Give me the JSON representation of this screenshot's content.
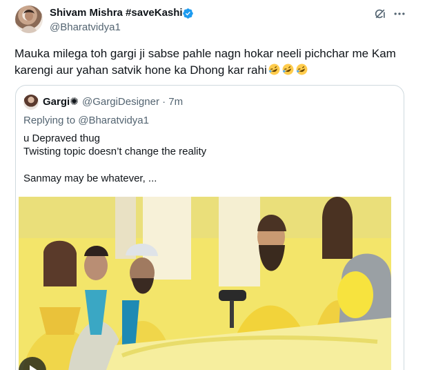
{
  "tweet": {
    "author_name": "Shivam Mishra #saveKashi",
    "author_handle": "@Bharatvidya1",
    "text": "Mauka milega toh gargi ji sabse pahle nagn hokar neeli pichchar me Kam karengi aur yahan satvik hone ka Dhong kar rahi",
    "emojis": [
      "rolling-on-floor-laughing",
      "rolling-on-floor-laughing",
      "rolling-on-floor-laughing"
    ],
    "icons": {
      "verified": "verified-badge-icon",
      "grok": "grok-icon",
      "more": "more-icon"
    },
    "accent": "#1d9bf0"
  },
  "quote": {
    "author_name": "Gargi✺",
    "author_handle": "@GargiDesigner · 7m",
    "replying_to": "Replying to @Bharatvidya1",
    "lines": [
      "u Depraved thug",
      "Twisting topic doesn’t change the reality",
      "Sanmay may be whatever, ..."
    ]
  },
  "colors": {
    "text": "#0f1419",
    "secondary": "#536471",
    "border": "#cfd9de",
    "media_yellow": "#f4e86a"
  }
}
